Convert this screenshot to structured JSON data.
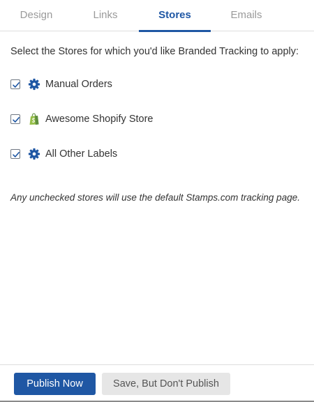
{
  "tabs": [
    {
      "label": "Design",
      "active": false
    },
    {
      "label": "Links",
      "active": false
    },
    {
      "label": "Stores",
      "active": true
    },
    {
      "label": "Emails",
      "active": false
    }
  ],
  "content": {
    "intro": "Select the Stores for which you'd like Branded Tracking to apply:",
    "stores": [
      {
        "label": "Manual Orders",
        "checked": true,
        "icon": "gear-icon"
      },
      {
        "label": "Awesome Shopify Store",
        "checked": true,
        "icon": "shopify-bag-icon"
      },
      {
        "label": "All Other Labels",
        "checked": true,
        "icon": "gear-icon"
      }
    ],
    "note": "Any unchecked stores will use the default Stamps.com tracking page."
  },
  "footer": {
    "publish_label": "Publish Now",
    "save_label": "Save, But Don't Publish"
  },
  "colors": {
    "accent": "#1f57a4",
    "shopify_green": "#96bf48",
    "secondary_button": "#e6e6e6"
  }
}
